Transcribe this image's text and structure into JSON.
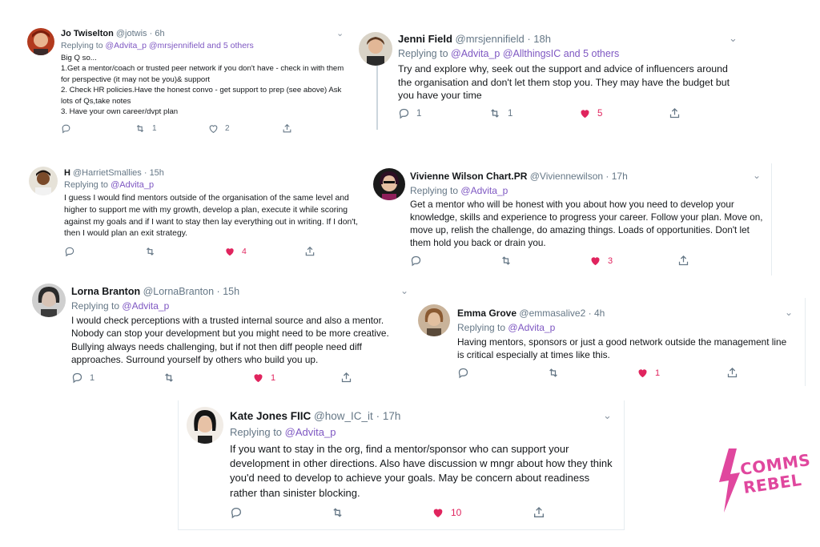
{
  "colors": {
    "accent": "#7e57c2",
    "like": "#e0245e",
    "brand": "#e0479e",
    "muted": "#657786"
  },
  "tweets": [
    {
      "name": "Jo Twiselton",
      "handle": "@jotwis",
      "sep": "·",
      "time": "6h",
      "replying_prefix": "Replying to",
      "replying_to": "@Advita_p @mrsjennifield and 5 others",
      "body": "Big Q so...\n1.Get a mentor/coach or trusted peer network if you don't have - check in with them for perspective (it may not be you)& support\n2. Check HR policies.Have the honest convo - get support to prep (see above) Ask lots of Qs,take notes\n3. Have your own career/dvpt plan",
      "replies": "",
      "retweets": "1",
      "likes": "2",
      "liked": false
    },
    {
      "name": "Jenni Field",
      "handle": "@mrsjennifield",
      "sep": "·",
      "time": "18h",
      "replying_prefix": "Replying to",
      "replying_to": "@Advita_p @AllthingsIC and 5 others",
      "body": "Try and explore why, seek out the support and advice of influencers around the organisation and don't let them stop you. They may have the budget but you have your time",
      "replies": "1",
      "retweets": "1",
      "likes": "5",
      "liked": true
    },
    {
      "name": "H",
      "handle": "@HarrietSmallies",
      "sep": "·",
      "time": "15h",
      "replying_prefix": "Replying to",
      "replying_to": "@Advita_p",
      "body": "I guess I would find mentors outside of the organisation of the same level and higher to support me with my growth, develop a plan, execute it while scoring against my goals and if I want to stay then lay everything out in writing. If I don't, then I would plan an exit strategy.",
      "replies": "",
      "retweets": "",
      "likes": "4",
      "liked": true
    },
    {
      "name": "Vivienne Wilson Chart.PR",
      "handle": "@Viviennewilson",
      "sep": "·",
      "time": "17h",
      "replying_prefix": "Replying to",
      "replying_to": "@Advita_p",
      "body": "Get a mentor who will be honest with you about how you need to develop your knowledge, skills and experience to progress your career. Follow your plan. Move on, move up, relish the challenge, do amazing things. Loads of opportunities. Don't let them hold you back or drain you.",
      "replies": "",
      "retweets": "",
      "likes": "3",
      "liked": true
    },
    {
      "name": "Lorna Branton",
      "handle": "@LornaBranton",
      "sep": "·",
      "time": "15h",
      "replying_prefix": "Replying to",
      "replying_to": "@Advita_p",
      "body": "I would check perceptions with a trusted internal source and also a mentor. Nobody can stop your development but you might need to be more creative. Bullying always needs challenging, but if not then diff people need diff approaches. Surround yourself by others who build you up.",
      "replies": "1",
      "retweets": "",
      "likes": "1",
      "liked": true
    },
    {
      "name": "Emma Grove",
      "handle": "@emmasalive2",
      "sep": "·",
      "time": "4h",
      "replying_prefix": "Replying to",
      "replying_to": "@Advita_p",
      "body": "Having mentors, sponsors or just a good network outside the management line is critical especially at times like this.",
      "replies": "",
      "retweets": "",
      "likes": "1",
      "liked": true
    },
    {
      "name": "Kate Jones FIIC",
      "handle": "@how_IC_it",
      "sep": "·",
      "time": "17h",
      "replying_prefix": "Replying to",
      "replying_to": "@Advita_p",
      "body": "If you want to stay in the org, find a mentor/sponsor who can support your development in other directions. Also have discussion w mngr about how they think you'd need to develop to achieve your goals. May be concern about readiness rather than sinister blocking.",
      "replies": "",
      "retweets": "",
      "likes": "10",
      "liked": true
    }
  ],
  "brand": {
    "line1": "COMMS",
    "line2": "REBEL",
    "icon": "lightning-bolt-icon"
  }
}
